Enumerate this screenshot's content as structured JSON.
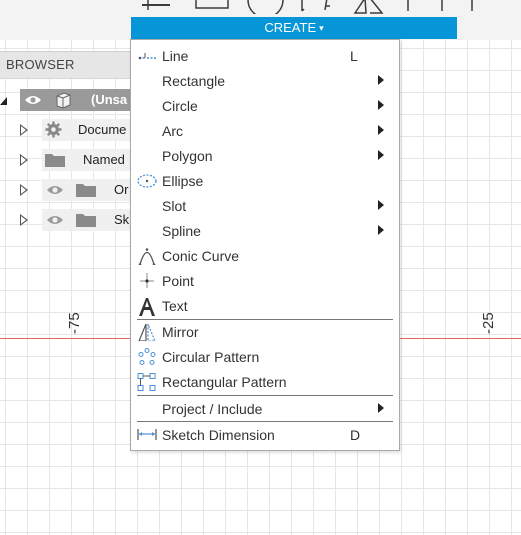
{
  "toolbar": {
    "create_label": "CREATE",
    "create_caret": "▾"
  },
  "canvas": {
    "axis_labels": [
      "-75",
      "-25"
    ],
    "axis_color": "#e06a60",
    "grid_color": "#e6e6e6"
  },
  "browser": {
    "title": "BROWSER",
    "items": [
      {
        "label": "(Unsa",
        "icon": "component-cube-icon",
        "selected": true
      },
      {
        "label": "Docume",
        "icon": "gear-icon"
      },
      {
        "label": "Named",
        "icon": "folder-icon"
      },
      {
        "label": "Or",
        "icon": "folder-icon"
      },
      {
        "label": "Sk",
        "icon": "folder-icon"
      }
    ]
  },
  "menu": {
    "accent": "#0696d7",
    "items": [
      {
        "label": "Line",
        "shortcut": "L",
        "icon": "line-icon"
      },
      {
        "label": "Rectangle",
        "submenu": true
      },
      {
        "label": "Circle",
        "submenu": true
      },
      {
        "label": "Arc",
        "submenu": true
      },
      {
        "label": "Polygon",
        "submenu": true
      },
      {
        "label": "Ellipse",
        "icon": "ellipse-icon"
      },
      {
        "label": "Slot",
        "submenu": true
      },
      {
        "label": "Spline",
        "submenu": true
      },
      {
        "label": "Conic Curve",
        "icon": "conic-curve-icon"
      },
      {
        "label": "Point",
        "icon": "point-icon"
      },
      {
        "label": "Text",
        "icon": "text-icon"
      },
      {
        "label": "Mirror",
        "icon": "mirror-icon"
      },
      {
        "label": "Circular Pattern",
        "icon": "circular-pattern-icon"
      },
      {
        "label": "Rectangular Pattern",
        "icon": "rectangular-pattern-icon"
      },
      {
        "label": "Project / Include",
        "submenu": true
      },
      {
        "label": "Sketch Dimension",
        "shortcut": "D",
        "icon": "sketch-dimension-icon"
      }
    ]
  }
}
